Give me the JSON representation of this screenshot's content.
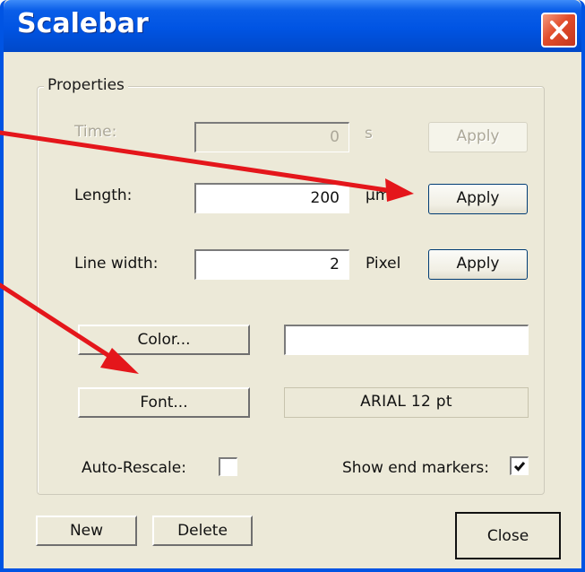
{
  "window": {
    "title": "Scalebar"
  },
  "properties_group": {
    "legend": "Properties",
    "time": {
      "label": "Time:",
      "value": "0",
      "unit": "s",
      "apply_label": "Apply",
      "enabled": false
    },
    "length": {
      "label": "Length:",
      "value": "200",
      "unit": "µm",
      "apply_label": "Apply",
      "enabled": true
    },
    "line_width": {
      "label": "Line width:",
      "value": "2",
      "unit": "Pixel",
      "apply_label": "Apply",
      "enabled": true
    },
    "color": {
      "button_label": "Color...",
      "swatch_color": "#ffffff"
    },
    "font": {
      "button_label": "Font...",
      "display": "ARIAL  12 pt"
    },
    "auto_rescale": {
      "label": "Auto-Rescale:",
      "checked": false
    },
    "show_end_markers": {
      "label": "Show end markers:",
      "checked": true
    }
  },
  "footer": {
    "new_label": "New",
    "delete_label": "Delete",
    "close_label": "Close"
  },
  "annotation": {
    "arrow_color": "#e4161b"
  },
  "icons": {
    "close": "close-icon",
    "checkmark": "checkmark-icon",
    "arrows": "annotation-arrow"
  }
}
